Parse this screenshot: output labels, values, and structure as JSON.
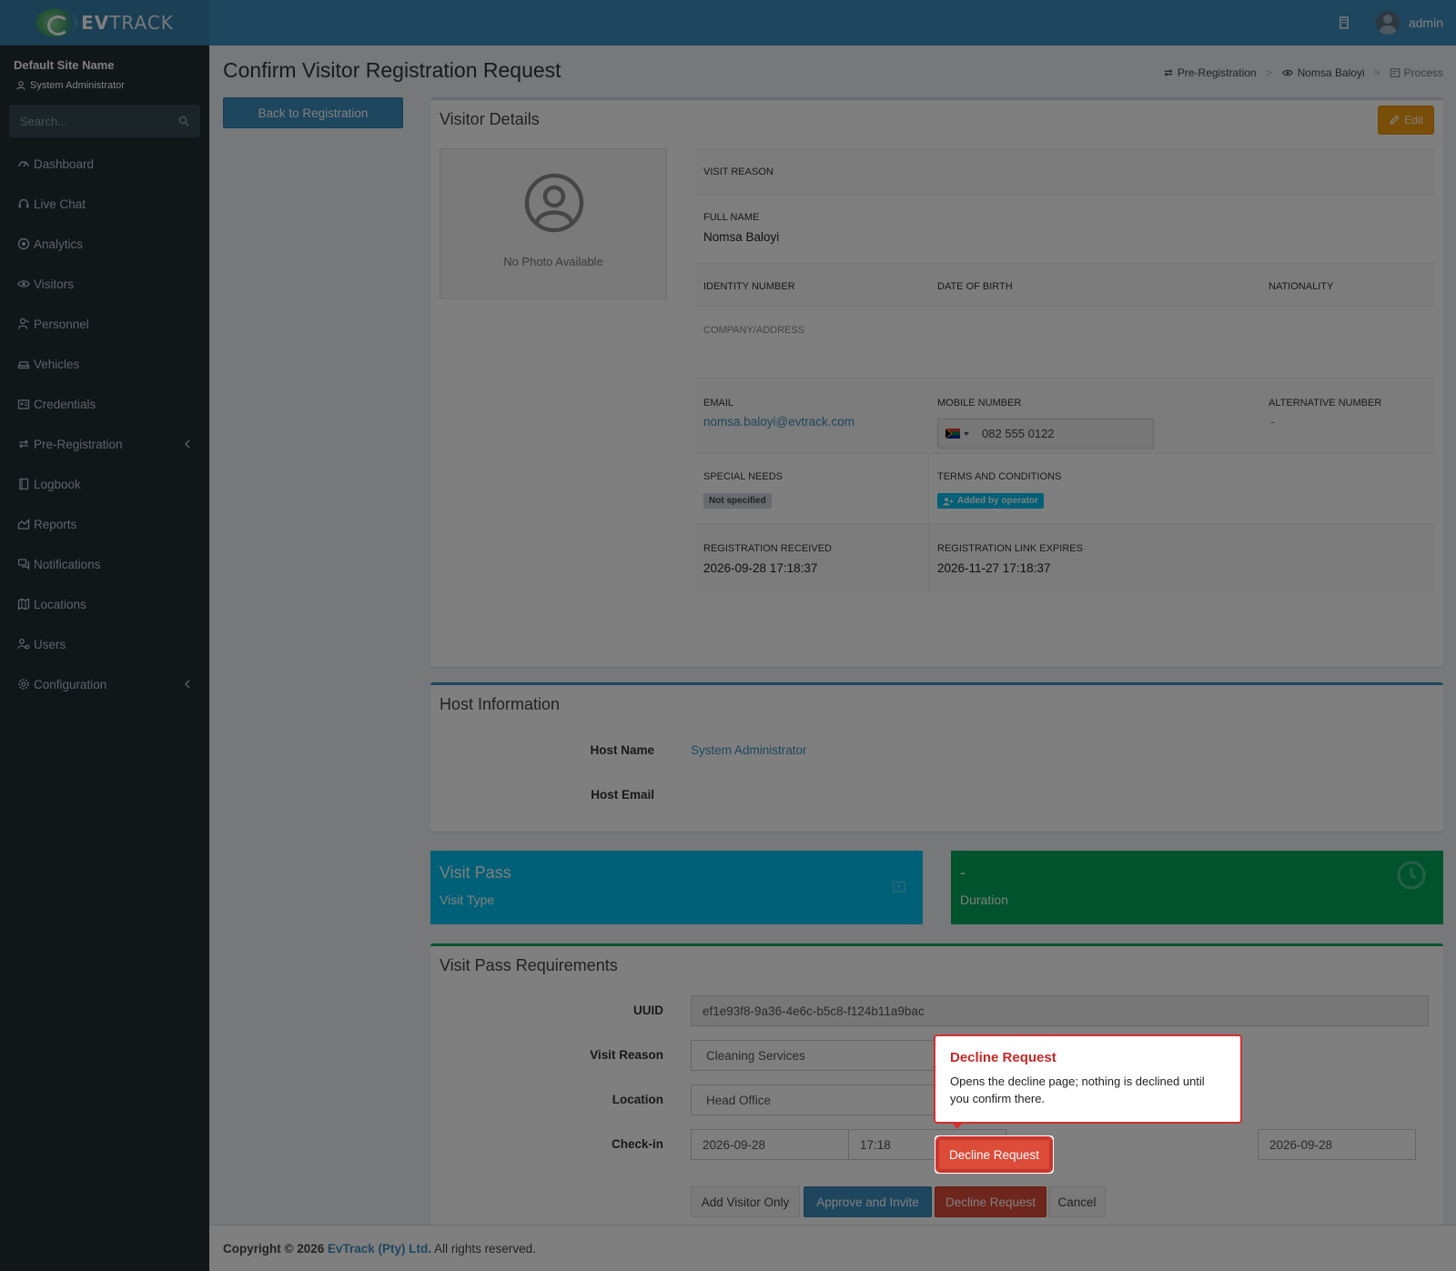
{
  "header": {
    "brand_bold": "EV",
    "brand_light": "TRACK",
    "user_name": "admin"
  },
  "sidebar": {
    "site_name": "Default Site Name",
    "role": "System Administrator",
    "search_placeholder": "Search...",
    "items": [
      {
        "label": "Dashboard",
        "icon": "dashboard-icon"
      },
      {
        "label": "Live Chat",
        "icon": "headset-icon"
      },
      {
        "label": "Analytics",
        "icon": "target-icon"
      },
      {
        "label": "Visitors",
        "icon": "eye-icon"
      },
      {
        "label": "Personnel",
        "icon": "user-tie-icon"
      },
      {
        "label": "Vehicles",
        "icon": "car-icon"
      },
      {
        "label": "Credentials",
        "icon": "id-card-icon"
      },
      {
        "label": "Pre-Registration",
        "icon": "exchange-icon"
      },
      {
        "label": "Logbook",
        "icon": "book-icon"
      },
      {
        "label": "Reports",
        "icon": "chart-icon"
      },
      {
        "label": "Notifications",
        "icon": "comments-icon"
      },
      {
        "label": "Locations",
        "icon": "map-icon"
      },
      {
        "label": "Users",
        "icon": "users-cog-icon"
      },
      {
        "label": "Configuration",
        "icon": "gear-icon"
      }
    ]
  },
  "page": {
    "title": "Confirm Visitor Registration Request",
    "back_label": "Back to Registration",
    "breadcrumb": [
      "Pre-Registration",
      "Nomsa Baloyi",
      "Process"
    ]
  },
  "visitor": {
    "box_title": "Visitor Details",
    "edit_label": "Edit",
    "no_photo": "No Photo Available",
    "visit_reason_label": "VISIT REASON",
    "full_name_label": "FULL NAME",
    "full_name": "Nomsa Baloyi",
    "identity_label": "IDENTITY NUMBER",
    "dob_label": "DATE OF BIRTH",
    "nationality_label": "NATIONALITY",
    "company_label": "COMPANY/ADDRESS",
    "email_label": "EMAIL",
    "email": "nomsa.baloyi@evtrack.com",
    "mobile_label": "MOBILE NUMBER",
    "mobile": "082 555 0122",
    "alt_label": "ALTERNATIVE NUMBER",
    "alt_value": "-",
    "special_label": "SPECIAL NEEDS",
    "special_value": "Not specified",
    "terms_label": "TERMS AND CONDITIONS",
    "terms_value": "Added by operator",
    "received_label": "REGISTRATION RECEIVED",
    "received": "2026-09-28 17:18:37",
    "expires_label": "REGISTRATION LINK EXPIRES",
    "expires": "2026-11-27 17:18:37"
  },
  "host": {
    "box_title": "Host Information",
    "name_label": "Host Name",
    "name": "System Administrator",
    "email_label": "Host Email"
  },
  "info_boxes": {
    "pass_big": "Visit Pass",
    "pass_small": "Visit Type",
    "duration_big": "-",
    "duration_small": "Duration"
  },
  "requirements": {
    "box_title": "Visit Pass Requirements",
    "uuid_label": "UUID",
    "uuid": "ef1e93f8-9a36-4e6c-b5c8-f124b11a9bac",
    "reason_label": "Visit Reason",
    "reason": "Cleaning Services",
    "location_label": "Location",
    "location": "Head Office",
    "checkin_label": "Check-in",
    "checkin_date": "2026-09-28",
    "checkin_time": "17:18",
    "checkout_date": "2026-09-28",
    "buttons": {
      "add_only": "Add Visitor Only",
      "approve": "Approve and Invite",
      "decline": "Decline Request",
      "cancel": "Cancel"
    }
  },
  "footer": {
    "prefix": "Copyright © 2026",
    "company": "EvTrack (Pty) Ltd.",
    "suffix": "All rights reserved."
  },
  "tooltip": {
    "title": "Decline Request",
    "body": "Opens the decline page; nothing is declined until you confirm there."
  },
  "colors": {
    "header": "#3c8dbc",
    "sidebar": "#222d32",
    "info_blue": "#00c0ef",
    "info_green": "#00a65a",
    "danger": "#dd4b39",
    "warning": "#f39c12"
  }
}
